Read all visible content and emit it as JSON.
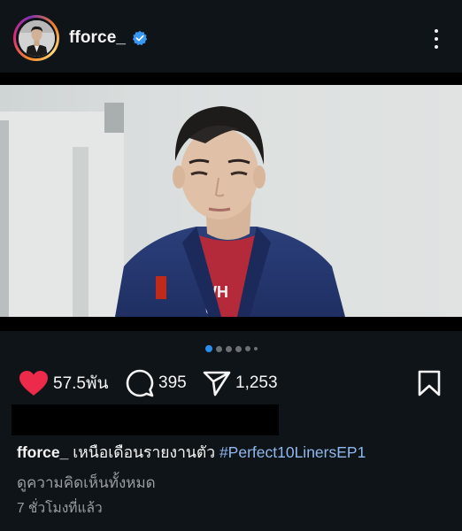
{
  "post": {
    "username": "fforce_",
    "verified": true,
    "icons": {
      "avatar": "profile-avatar",
      "verified": "verified-badge-icon",
      "more": "more-vertical-icon",
      "like": "heart-filled-icon",
      "comment": "comment-bubble-icon",
      "share": "paper-plane-icon",
      "save": "bookmark-icon"
    },
    "carousel": {
      "total": 6,
      "active_index": 0
    },
    "likes": "57.5พัน",
    "comments": "395",
    "shares": "1,253",
    "caption": {
      "username": "fforce_",
      "text": "เหนือเดือนรายงานตัว",
      "hashtag": "#Perfect10LinersEP1"
    },
    "view_comments_label": "ดูความคิดเห็นทั้งหมด",
    "timestamp": "7 ชั่วโมงที่แล้ว"
  },
  "colors": {
    "background": "#0f1418",
    "like_red": "#ee2a4a",
    "hashtag_blue": "#8fb8ee",
    "verified_blue": "#3897f0",
    "carousel_active": "#2a8fe8",
    "muted_text": "#9a9ea3"
  }
}
